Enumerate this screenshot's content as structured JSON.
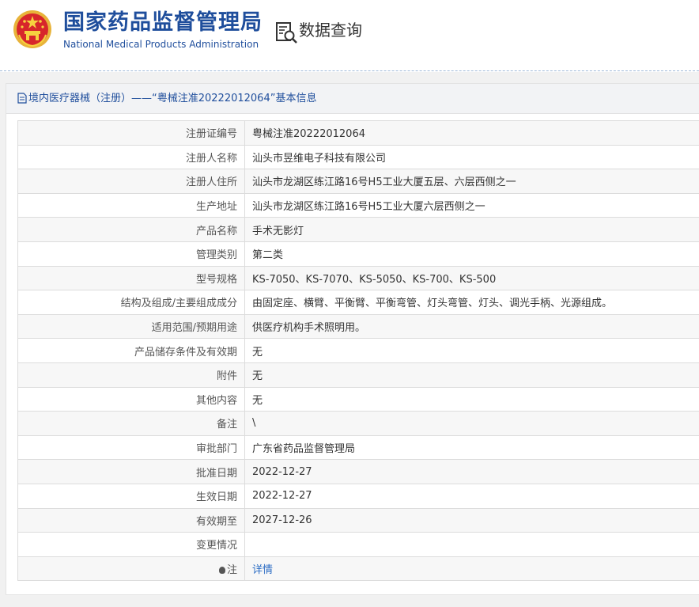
{
  "header": {
    "agency_cn": "国家药品监督管理局",
    "agency_en": "National Medical Products Administration",
    "section_title": "数据查询",
    "emblem_icon": "national-emblem-icon",
    "query_icon": "document-search-icon"
  },
  "panel": {
    "title": "境内医疗器械（注册）——“粤械注准20222012064”基本信息",
    "title_icon": "document-icon"
  },
  "rows": [
    {
      "label": "注册证编号",
      "value": "粤械注准20222012064"
    },
    {
      "label": "注册人名称",
      "value": "汕头市昱维电子科技有限公司"
    },
    {
      "label": "注册人住所",
      "value": "汕头市龙湖区练江路16号H5工业大厦五层、六层西侧之一"
    },
    {
      "label": "生产地址",
      "value": "汕头市龙湖区练江路16号H5工业大厦六层西侧之一"
    },
    {
      "label": "产品名称",
      "value": "手术无影灯"
    },
    {
      "label": "管理类别",
      "value": "第二类"
    },
    {
      "label": "型号规格",
      "value": "KS-7050、KS-7070、KS-5050、KS-700、KS-500"
    },
    {
      "label": "结构及组成/主要组成成分",
      "value": "由固定座、横臂、平衡臂、平衡弯管、灯头弯管、灯头、调光手柄、光源组成。"
    },
    {
      "label": "适用范围/预期用途",
      "value": "供医疗机构手术照明用。"
    },
    {
      "label": "产品储存条件及有效期",
      "value": "无"
    },
    {
      "label": "附件",
      "value": "无"
    },
    {
      "label": "其他内容",
      "value": "无"
    },
    {
      "label": "备注",
      "value": "\\"
    },
    {
      "label": "审批部门",
      "value": "广东省药品监督管理局"
    },
    {
      "label": "批准日期",
      "value": "2022-12-27"
    },
    {
      "label": "生效日期",
      "value": "2022-12-27"
    },
    {
      "label": "有效期至",
      "value": "2027-12-26"
    },
    {
      "label": "变更情况",
      "value": ""
    }
  ],
  "note_row": {
    "label": "注",
    "link": "详情",
    "icon": "lightbulb-icon"
  }
}
